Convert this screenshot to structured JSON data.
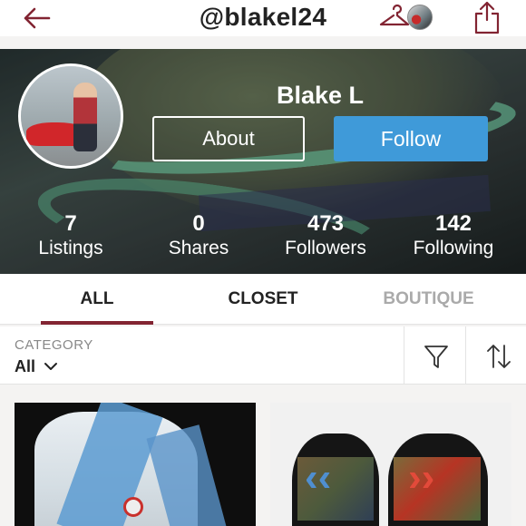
{
  "header": {
    "handle": "@blakel24"
  },
  "profile": {
    "name": "Blake L",
    "about_label": "About",
    "follow_label": "Follow"
  },
  "stats": [
    {
      "value": "7",
      "label": "Listings"
    },
    {
      "value": "0",
      "label": "Shares"
    },
    {
      "value": "473",
      "label": "Followers"
    },
    {
      "value": "142",
      "label": "Following"
    }
  ],
  "tabs": [
    {
      "label": "ALL",
      "active": true
    },
    {
      "label": "CLOSET",
      "active": false
    },
    {
      "label": "BOUTIQUE",
      "active": false
    }
  ],
  "filter": {
    "category_label": "CATEGORY",
    "category_value": "All"
  },
  "colors": {
    "accent": "#822432",
    "follow": "#3f9ad9",
    "inactive_tab": "#aaaaaa"
  },
  "icons": {
    "back": "back-arrow-icon",
    "hanger": "hanger-icon",
    "share": "share-icon",
    "filter": "filter-funnel-icon",
    "sort": "sort-arrows-icon",
    "chevron": "chevron-down-icon"
  }
}
